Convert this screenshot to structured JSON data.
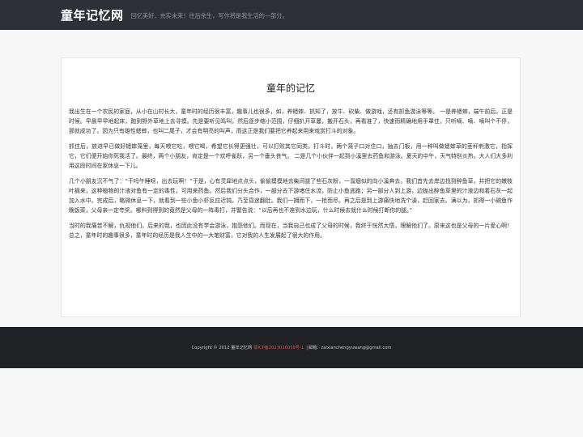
{
  "header": {
    "site_title": "童年记忆网",
    "tagline": "回忆美好，充实未来！往后余生，写作将是我生活的一部分。"
  },
  "article": {
    "title": "童年的记忆",
    "paragraphs": [
      "我出生在一个农民的家庭，从小在山村长大，童年时的经历很丰富，趣事儿也很多，如，养蟋蟀、抓知了，放牛、砍柴、做游戏，还有抓鱼游泳等等。 一是养蟋蟀，端午前后，正是时候。早晨早早地起床，跑到野外草地上去寻摸。先是要听见鸣叫，然后逐步缩小范围，仔细扒开草蔓，搬开石头，再看准了，快速而精确地用手罩住，只听嘀、嘀、嘀叫个不停，那就成功了。因为只有雄性蟋蟀，也叫二尾子，才会有明亮的叫声，而这正是我们要把它养起来用来戏赏打斗的对象。",
      "抓住后，放进早已做好蟋蟀笼里，每天喂它吃，喂它喝，希望它长得更强壮，可以打败其它同类。打斗时，两个笼子口对住口，抽去门板，用一种叫做蟋蟀草的茎秆刺激它，指挥它，它们便开始你死我活了。最终，两个小朋友，肯定是一个欢呼雀跃，另一个垂头丧气。 二是几个小伙伴一起到小溪里去药鱼和游泳。夏天的中午，天气特别炎热，大人们大多利用这段时间在家休息一下儿。",
      "几个小朋友沉不气了：“干吗午睡呀，出去玩啊！”于是，心有灵犀地点点头，偷偷摸摸地去柴间拔了些石灰粉，一溜烟似的向小溪奔去。我们首先去岸边找到醉鱼草，并把它的嫩枝叶摘来，这种植物的汁液对鱼有一定的毒性，可用来药鱼。然后我们分头合作，一部分去下游堵住水流，防止小鱼逃跑；另一部分人到上游，边拢出醉鱼草里的汁液边和着石灰一起加入水中。完成后，略微休息一下，就看到一些小鱼小虾反应迟钝，乃至昏迷翻肚。我们一拥而下，一抢而尽。再之后是到上游痛快地洗个澡，赶回家去。满以为，抓得一小碗鱼作晚饭菜，父母亲一定夸奖。哪料到得到的竟然是父母的一阵毒打，并警告说：“以后再也不准到水边玩，什么时候去就什么时候打断你的腿。”",
      "当时的我痛苦不解，仇视他们。后来的我，也因此没有学会游泳，抱怨他们。而现在，当我自己也成了父母的时候，我终于恍然大悟，理解他们了。原来这也是父母的一片爱心啊！ 总之，童年时的趣事很多，童年时的经历是我人生中的一大笔财富，它对我的人生发展起了很大的作用。"
    ]
  },
  "footer": {
    "copyright": "Copyright © 2012 童年记忆网",
    "icp": "鄂ICP备2023016059号-1",
    "separator": "|",
    "email": "邮箱：zaixianchengyuwang@gmail.com"
  },
  "colors": {
    "topbar": "#2d3036",
    "footer": "#1f2124",
    "icp_link": "#d9534f"
  }
}
